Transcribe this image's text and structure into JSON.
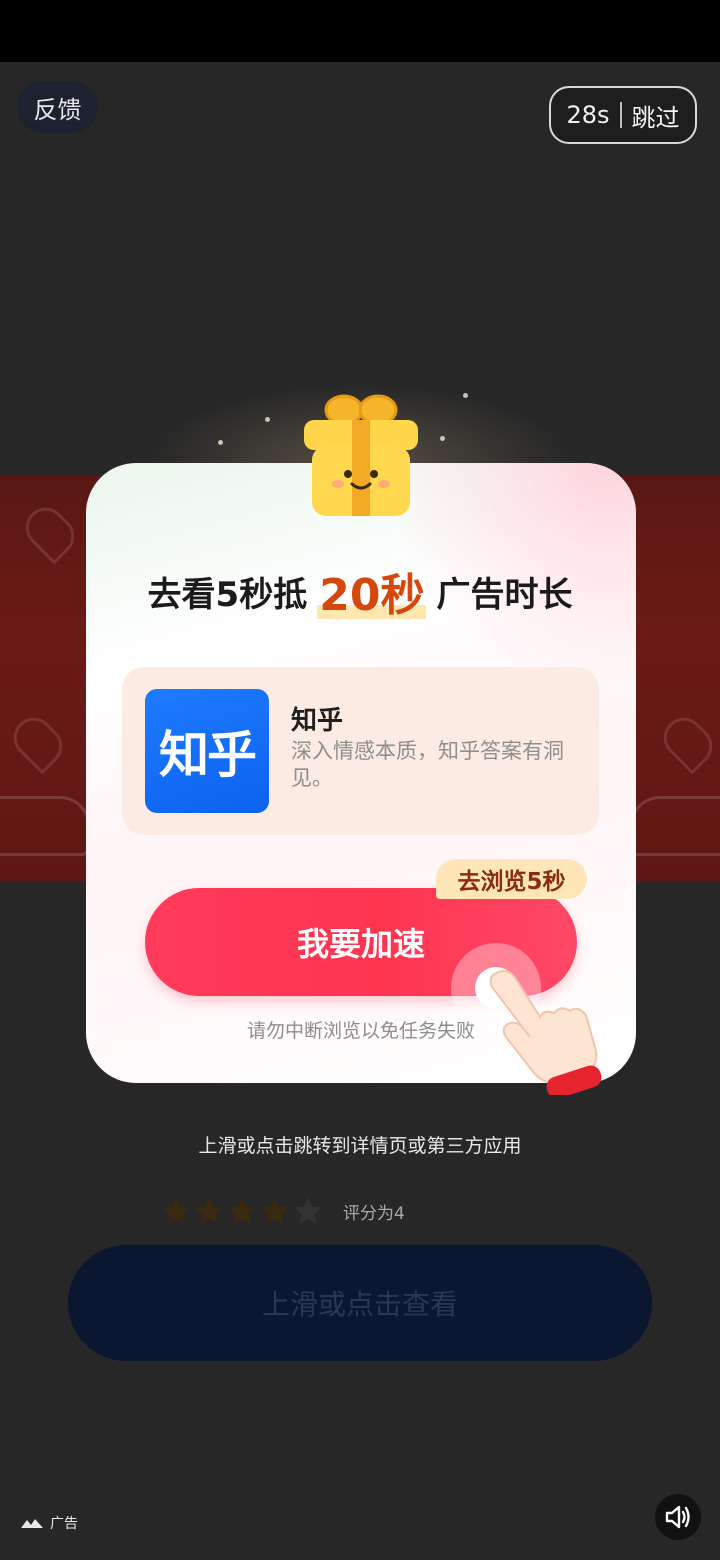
{
  "header": {
    "feedback_label": "反馈",
    "countdown": "28s",
    "skip_label": "跳过"
  },
  "card": {
    "title_prefix": "去看5秒抵",
    "title_highlight": "20秒",
    "title_suffix": "广告时长",
    "app": {
      "icon_text": "知乎",
      "name": "知乎",
      "description": "深入情感本质，知乎答案有洞见。"
    },
    "browse_tag": "去浏览5秒",
    "accelerate_button": "我要加速",
    "warning": "请勿中断浏览以免任务失败"
  },
  "swipe_hint": "上滑或点击跳转到详情页或第三方应用",
  "rating": {
    "value": 4,
    "max": 5,
    "text": "评分为4"
  },
  "view_button": "上滑或点击查看",
  "ad_label": "广告",
  "colors": {
    "accent_red": "#ff3a5b",
    "highlight_orange": "#d6470c",
    "app_blue": "#0b62ef",
    "star_color": "#3a2a10"
  }
}
